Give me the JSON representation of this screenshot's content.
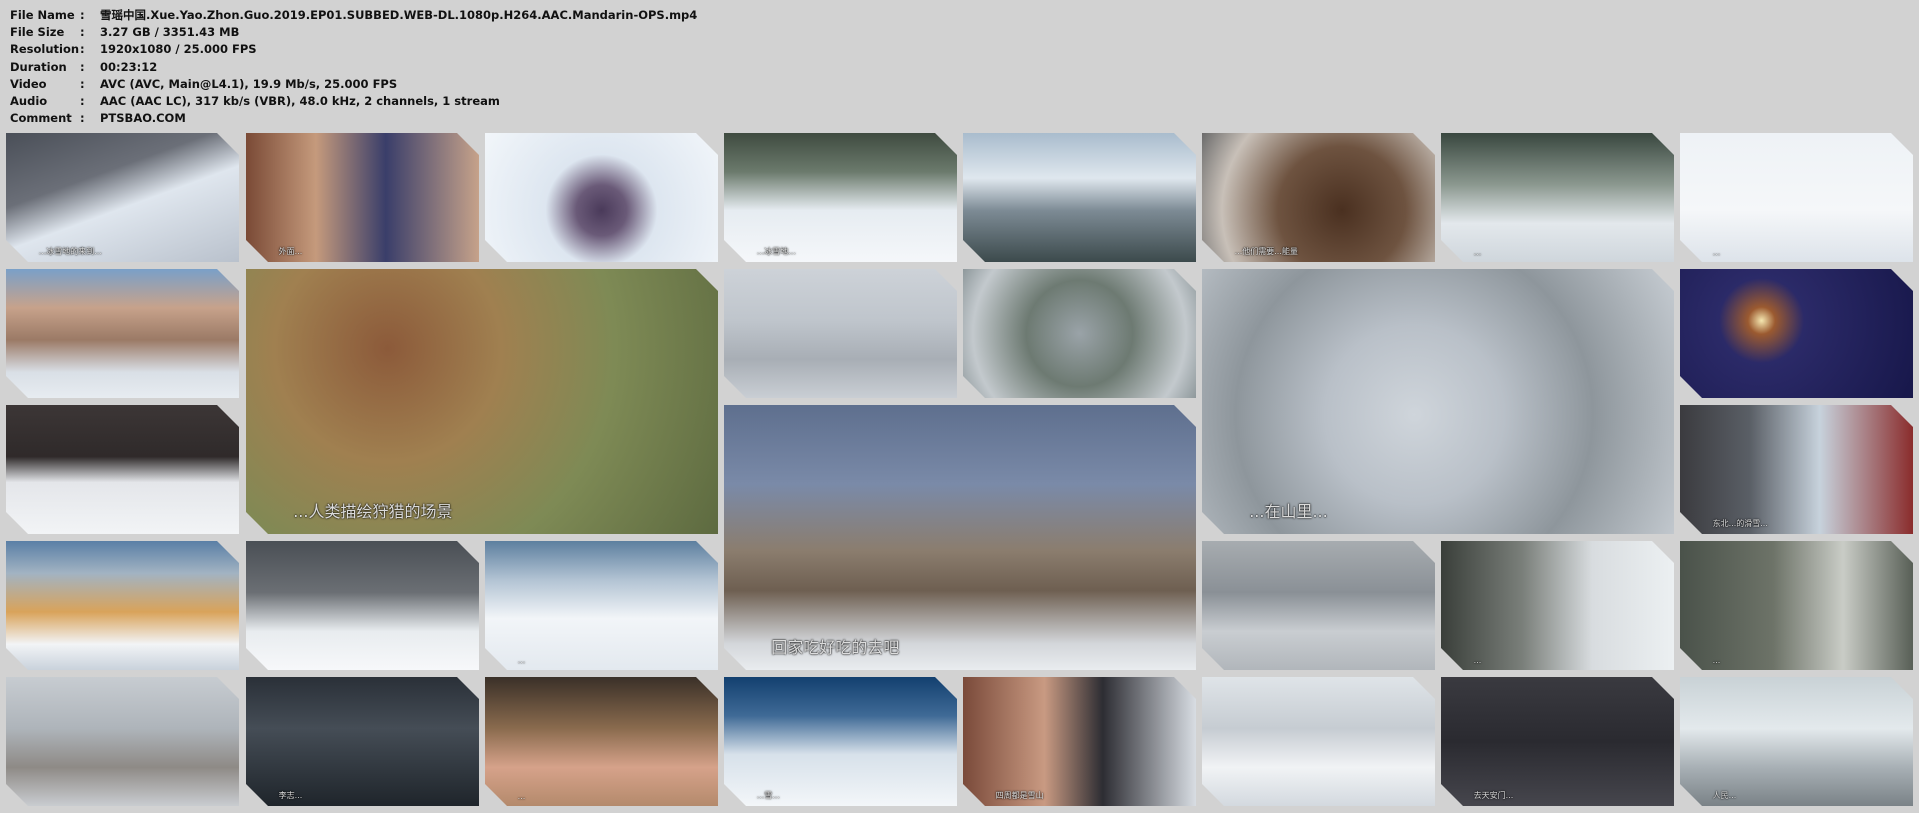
{
  "info": [
    {
      "label": "File Name",
      "sep": ":",
      "value": "雪瑶中国.Xue.Yao.Zhon.Guo.2019.EP01.SUBBED.WEB-DL.1080p.H264.AAC.Mandarin-OPS.mp4"
    },
    {
      "label": "File Size",
      "sep": ":",
      "value": "3.27 GB  /  3351.43 MB"
    },
    {
      "label": "Resolution",
      "sep": ":",
      "value": "1920x1080 / 25.000 FPS"
    },
    {
      "label": "Duration",
      "sep": ":",
      "value": "00:23:12"
    },
    {
      "label": "Video",
      "sep": ":",
      "value": "AVC (AVC, Main@L4.1), 19.9 Mb/s, 25.000 FPS"
    },
    {
      "label": "Audio",
      "sep": ":",
      "value": "AAC (AAC LC), 317 kb/s (VBR), 48.0 kHz, 2 channels, 1 stream"
    },
    {
      "label": "Comment",
      "sep": ":",
      "value": "PTSBAO.COM"
    }
  ],
  "thumbs": [
    {
      "sub": "...冰雪地的来到...",
      "bg": "linear-gradient(160deg,#4a4f58 0%,#6b6f78 35%,#dfe6ee 55%,#b9c1cc 100%)"
    },
    {
      "sub": "外面...",
      "bg": "linear-gradient(90deg,#7a4a36 0%,#c59a7c 30%,#3a3e6a 60%,#c6a28a 100%)"
    },
    {
      "sub": "",
      "bg": "radial-gradient(circle at 50% 60%,#4a3a5a 0%,#6a5a78 18%,#dde6f0 40%,#f2f6fa 100%)"
    },
    {
      "sub": "...冰雪地...",
      "bg": "linear-gradient(180deg,#3f4b40 0%,#6b7a6c 30%,#e6ecf1 60%,#f5f7fa 100%)"
    },
    {
      "sub": "",
      "bg": "linear-gradient(180deg,#a9bccd 0%,#dfe7ee 35%,#7d8b95 60%,#3c4a4c 100%)"
    },
    {
      "sub": "...他们需要...能量",
      "bg": "radial-gradient(circle at 60% 60%,#4a3020 0%,#6e5340 40%,#c8c0b8 75%,#6b6b6b 100%)"
    },
    {
      "sub": "...",
      "bg": "linear-gradient(180deg,#39473f 0%,#8b988f 40%,#e3e8ec 70%,#cfd6dc 100%)"
    },
    {
      "sub": "...",
      "bg": "linear-gradient(180deg,#eef2f6 0%,#f5f7f9 60%,#dde3ea 100%)"
    },
    {
      "sub": "",
      "bg": "linear-gradient(180deg,#7aa0c8 0%,#c7a28b 30%,#9b7a66 55%,#d9dfe6 80%,#e7ecf1 100%)"
    },
    {
      "sub": "...人类描绘狩猎的场景",
      "bg": "radial-gradient(circle at 30% 30%,#8c5a3a 0%,#a08050 30%,#7e8a55 60%,#5d6a40 100%)",
      "big": true
    },
    {
      "sub": "",
      "bg": "linear-gradient(180deg,#cdd2d8 0%,#bfc5cc 40%,#a8aeb5 70%,#c9ced4 100%)"
    },
    {
      "sub": "",
      "bg": "radial-gradient(circle at 50% 50%,#9aa3a8 0%,#6d7a72 40%,#c3c9cd 80%,#8e989b 100%)"
    },
    {
      "sub": "...在山里...",
      "bg": "radial-gradient(circle at 45% 55%,#cfd5db 0%,#b9c0c8 30%,#8e969c 60%,#c7cdd3 100%)",
      "big": true
    },
    {
      "sub": "",
      "bg": "radial-gradient(circle at 35% 40%,#f5e7b0 0%,#9b5a30 8%,#2b2a68 25%,#17174a 100%)"
    },
    {
      "sub": "",
      "bg": "linear-gradient(180deg,#3c3636 0%,#2f2a2a 40%,#e4e6ea 60%,#f2f4f6 100%)"
    },
    {
      "sub": "回家吃好吃的去吧",
      "bg": "linear-gradient(180deg,#5e6f8e 0%,#7a8aa8 30%,#8b7d6e 55%,#6e5f51 70%,#d3d6da 90%,#e9ecef 100%)",
      "big": true
    },
    {
      "sub": "东北...的滑雪...",
      "bg": "linear-gradient(90deg,#3b3b3f 0%,#5a5f66 30%,#c7d2dc 60%,#8a2c2c 100%)"
    },
    {
      "sub": "",
      "bg": "linear-gradient(180deg,#5a7fa6 0%,#a2b3c2 25%,#d9a35a 55%,#f2f4f6 80%,#c9d2dc 100%)"
    },
    {
      "sub": "",
      "bg": "linear-gradient(180deg,#4a4f55 0%,#6b6f74 40%,#e8ecef 70%,#f7f8fa 100%)"
    },
    {
      "sub": "...",
      "bg": "linear-gradient(180deg,#5d7f9f 0%,#b2c3d3 30%,#f2f5f8 60%,#e3e9ef 100%)"
    },
    {
      "sub": "",
      "bg": "linear-gradient(180deg,#a7acb0 0%,#8a9096 40%,#c9cdd1 70%,#b1b6bb 100%)"
    },
    {
      "sub": "...",
      "bg": "linear-gradient(90deg,#3a3f3a 0%,#7a7f7a 35%,#d8dcdf 65%,#ecf0f2 100%)"
    },
    {
      "sub": "...",
      "bg": "linear-gradient(90deg,#4a524a 0%,#6d7368 40%,#c9ccc6 70%,#585f56 100%)"
    },
    {
      "sub": "",
      "bg": "linear-gradient(180deg,#c7ccd1 0%,#aeb4ba 40%,#8e8a86 70%,#c9ccd0 100%)"
    },
    {
      "sub": "李志...",
      "bg": "linear-gradient(180deg,#2a3038 0%,#454d56 40%,#1f252b 100%)"
    },
    {
      "sub": "...",
      "bg": "linear-gradient(180deg,#3a3028 0%,#8a6b4e 40%,#d6a28a 70%,#b48a6c 100%)"
    },
    {
      "sub": "...雪...",
      "bg": "linear-gradient(180deg,#13406f 0%,#3f6a96 30%,#d7e1ea 60%,#f3f6f9 100%)"
    },
    {
      "sub": "四周都是雪山",
      "bg": "linear-gradient(90deg,#7a4a3a 0%,#c99a82 35%,#2d2d33 60%,#d8dde3 100%)"
    },
    {
      "sub": "",
      "bg": "linear-gradient(180deg,#dfe4e8 0%,#c6ccd2 40%,#f1f3f5 70%,#d3d9df 100%)"
    },
    {
      "sub": "去天安门...",
      "bg": "linear-gradient(180deg,#3a3a40 0%,#2a2a30 50%,#46464d 100%)"
    },
    {
      "sub": "人民...",
      "bg": "linear-gradient(180deg,#c9d2d6 0%,#e3e9ec 40%,#a8b0b5 70%,#7a8287 100%)"
    }
  ]
}
